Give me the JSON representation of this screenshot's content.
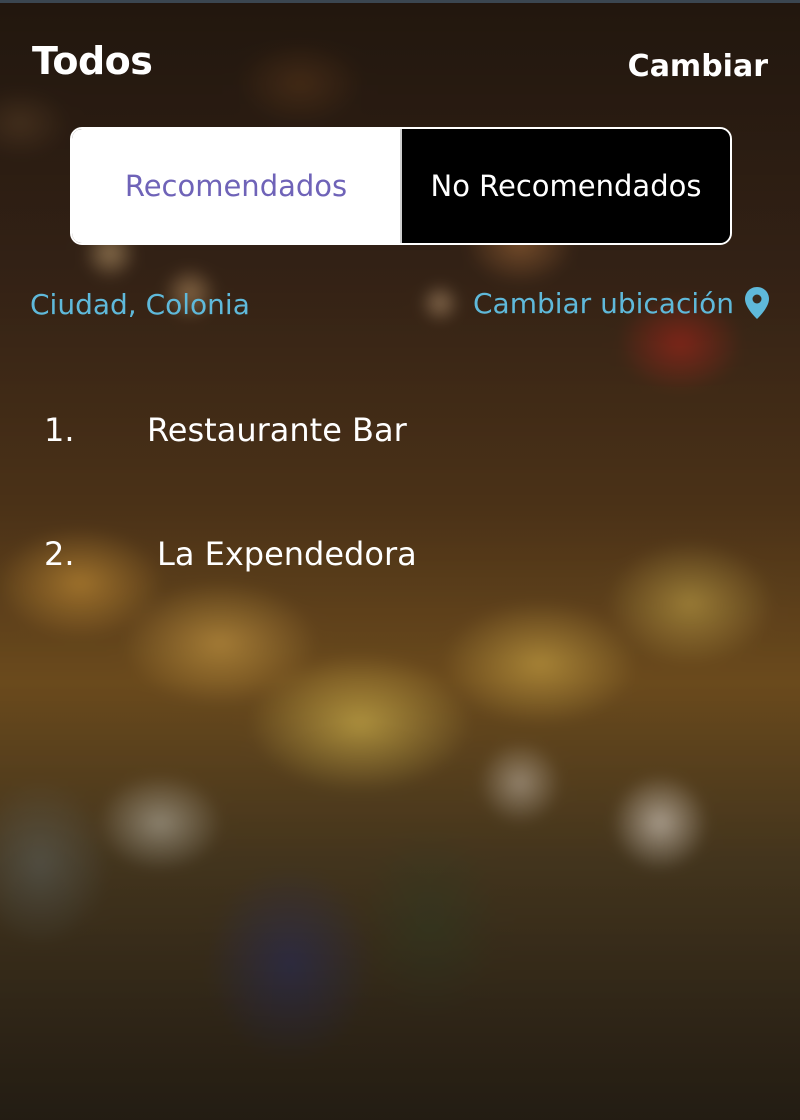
{
  "header": {
    "title": "Todos",
    "action_label": "Cambiar"
  },
  "tabs": [
    {
      "label": "Recomendados",
      "selected": false
    },
    {
      "label": "No Recomendados",
      "selected": true
    }
  ],
  "location": {
    "current": "Ciudad, Colonia",
    "change_label": "Cambiar ubicación",
    "icon": "location-pin-icon"
  },
  "results": [
    {
      "number": "1.",
      "name": "Restaurante Bar"
    },
    {
      "number": "2.",
      "name": "La Expendedora"
    }
  ],
  "colors": {
    "accent_blue": "#5fb9da",
    "tab_selected_bg": "#000000",
    "tab_unselected_bg": "#ffffff",
    "tab_unselected_text": "#6f63b8"
  }
}
